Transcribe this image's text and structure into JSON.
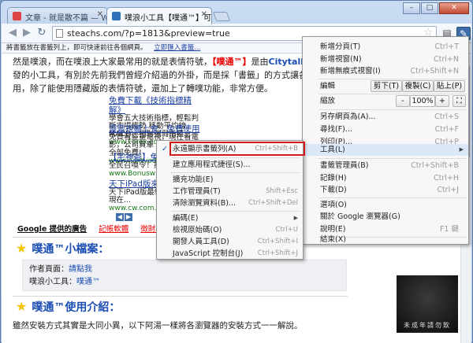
{
  "window": {
    "controls": [
      "–",
      "□",
      "✕"
    ]
  },
  "tabs": [
    {
      "title": "文章 - 就是散不篇 — Wo...",
      "active": false
    },
    {
      "title": "噗浪小工具【噗通™】可...",
      "active": true
    }
  ],
  "toolbar": {
    "url": "steachs.com/?p=1813&preview=true",
    "back_icon": "back-arrow-icon",
    "forward_icon": "forward-arrow-icon",
    "reload_icon": "reload-icon"
  },
  "bookmark_bar": {
    "message": "將書籤放在書籤列上，即可快速前往各個網頁。",
    "link": "立即匯入書籤..."
  },
  "content": {
    "line1_a": "然是噗浪，而在噗浪上大家最常用的就是表情符號，",
    "line1_brand": "【噗通™】",
    "line1_b": "是由",
    "line1_link": "Citytalk城市",
    "line2": "發的小工具，有別於先前我們曾經介紹過的外掛，而是採「書籤」的方式讓各",
    "line3": "用，除了能使用隱藏版的表情符號，還加上了轉噗功能，非常方便。",
    "ads": [
      {
        "title": "免費下載《技術指標精解》",
        "body": "學會五大技術指標，輕鬆判斷市場趨勢 移動平均線、MACD、相對強弱指標...",
        "url": "www.Forex.com"
      },
      {
        "title": "靈靈視聽上會，免費使用",
        "body": "免費看靈靈電視，現在看電影，公司買單 電影、影集、全部免費!",
        "url": "www.nextvod.com.tw"
      },
      {
        "title": "【宅神爺】免費",
        "body": "全民召喚令！推薦... 宅神爺",
        "url": "www.Bonuswinner..."
      },
      {
        "title": "天下iPad版來臨",
        "body": "天下iPad版最新... 的版面，現在...",
        "url": "www.cw.com.tw"
      }
    ],
    "ad_label": "Google 提供的廣告",
    "ad_keywords": [
      "記帳軟體",
      "徵財軟體",
      "隱"
    ],
    "section1_title": "噗通™小檔案：",
    "author_label": "作者頁面：",
    "author_link": "請點我",
    "tool_label": "噗浪小工具：",
    "tool_link": "噗通™",
    "section2_title": "噗通™使用介紹：",
    "bottom_text": "雖然安裝方式其實是大同小異，以下阿湯一樣將各瀏覽器的安裝方式一一解說。",
    "photo_caption": "未成年請勿飲"
  },
  "wrench_menu": {
    "new_tab": {
      "label": "新增分頁(T)",
      "shortcut": "Ctrl+T"
    },
    "new_window": {
      "label": "新增視窗(N)",
      "shortcut": "Ctrl+N"
    },
    "new_incognito": {
      "label": "新增無痕式視窗(I)",
      "shortcut": "Ctrl+Shift+N"
    },
    "edit_label": "編輯",
    "cut": "剪下(T)",
    "copy": "複製(C)",
    "paste": "貼上(P)",
    "zoom_label": "縮放",
    "zoom_minus": "-",
    "zoom_value": "100%",
    "zoom_plus": "+",
    "save_as": {
      "label": "另存網頁為(A)...",
      "shortcut": "Ctrl+S"
    },
    "find": {
      "label": "尋找(F)...",
      "shortcut": "Ctrl+F"
    },
    "print": {
      "label": "列印(P)...",
      "shortcut": "Ctrl+P"
    },
    "tools": {
      "label": "工具(L)"
    },
    "bookmark_manager": {
      "label": "書籤管理員(B)",
      "shortcut": "Ctrl+Shift+B"
    },
    "history": {
      "label": "記錄(H)",
      "shortcut": "Ctrl+H"
    },
    "downloads": {
      "label": "下載(D)",
      "shortcut": "Ctrl+J"
    },
    "options": {
      "label": "選項(O)"
    },
    "about": {
      "label": "關於 Google 瀏覽器(G)"
    },
    "help": {
      "label": "說明(E)",
      "shortcut": "F1 鍵"
    },
    "exit": {
      "label": "結束(X)"
    }
  },
  "tools_submenu": {
    "always_show_bookmarks": {
      "label": "永遠顯示書籤列(A)",
      "shortcut": "Ctrl+Shift+B",
      "checked": true
    },
    "create_app_shortcuts": {
      "label": "建立應用程式捷徑(S)..."
    },
    "extensions": {
      "label": "擴充功能(E)"
    },
    "task_manager": {
      "label": "工作管理員(T)",
      "shortcut": "Shift+Esc"
    },
    "clear_browsing_data": {
      "label": "清除瀏覽資料(B)...",
      "shortcut": "Ctrl+Shift+Del"
    },
    "encoding": {
      "label": "編碼(E)"
    },
    "view_source": {
      "label": "檢視原始碼(O)",
      "shortcut": "Ctrl+U"
    },
    "developer_tools": {
      "label": "開發人員工具(D)",
      "shortcut": "Ctrl+Shift+I"
    },
    "js_console": {
      "label": "JavaScript 控制台(J)",
      "shortcut": "Ctrl+Shift+J"
    }
  }
}
